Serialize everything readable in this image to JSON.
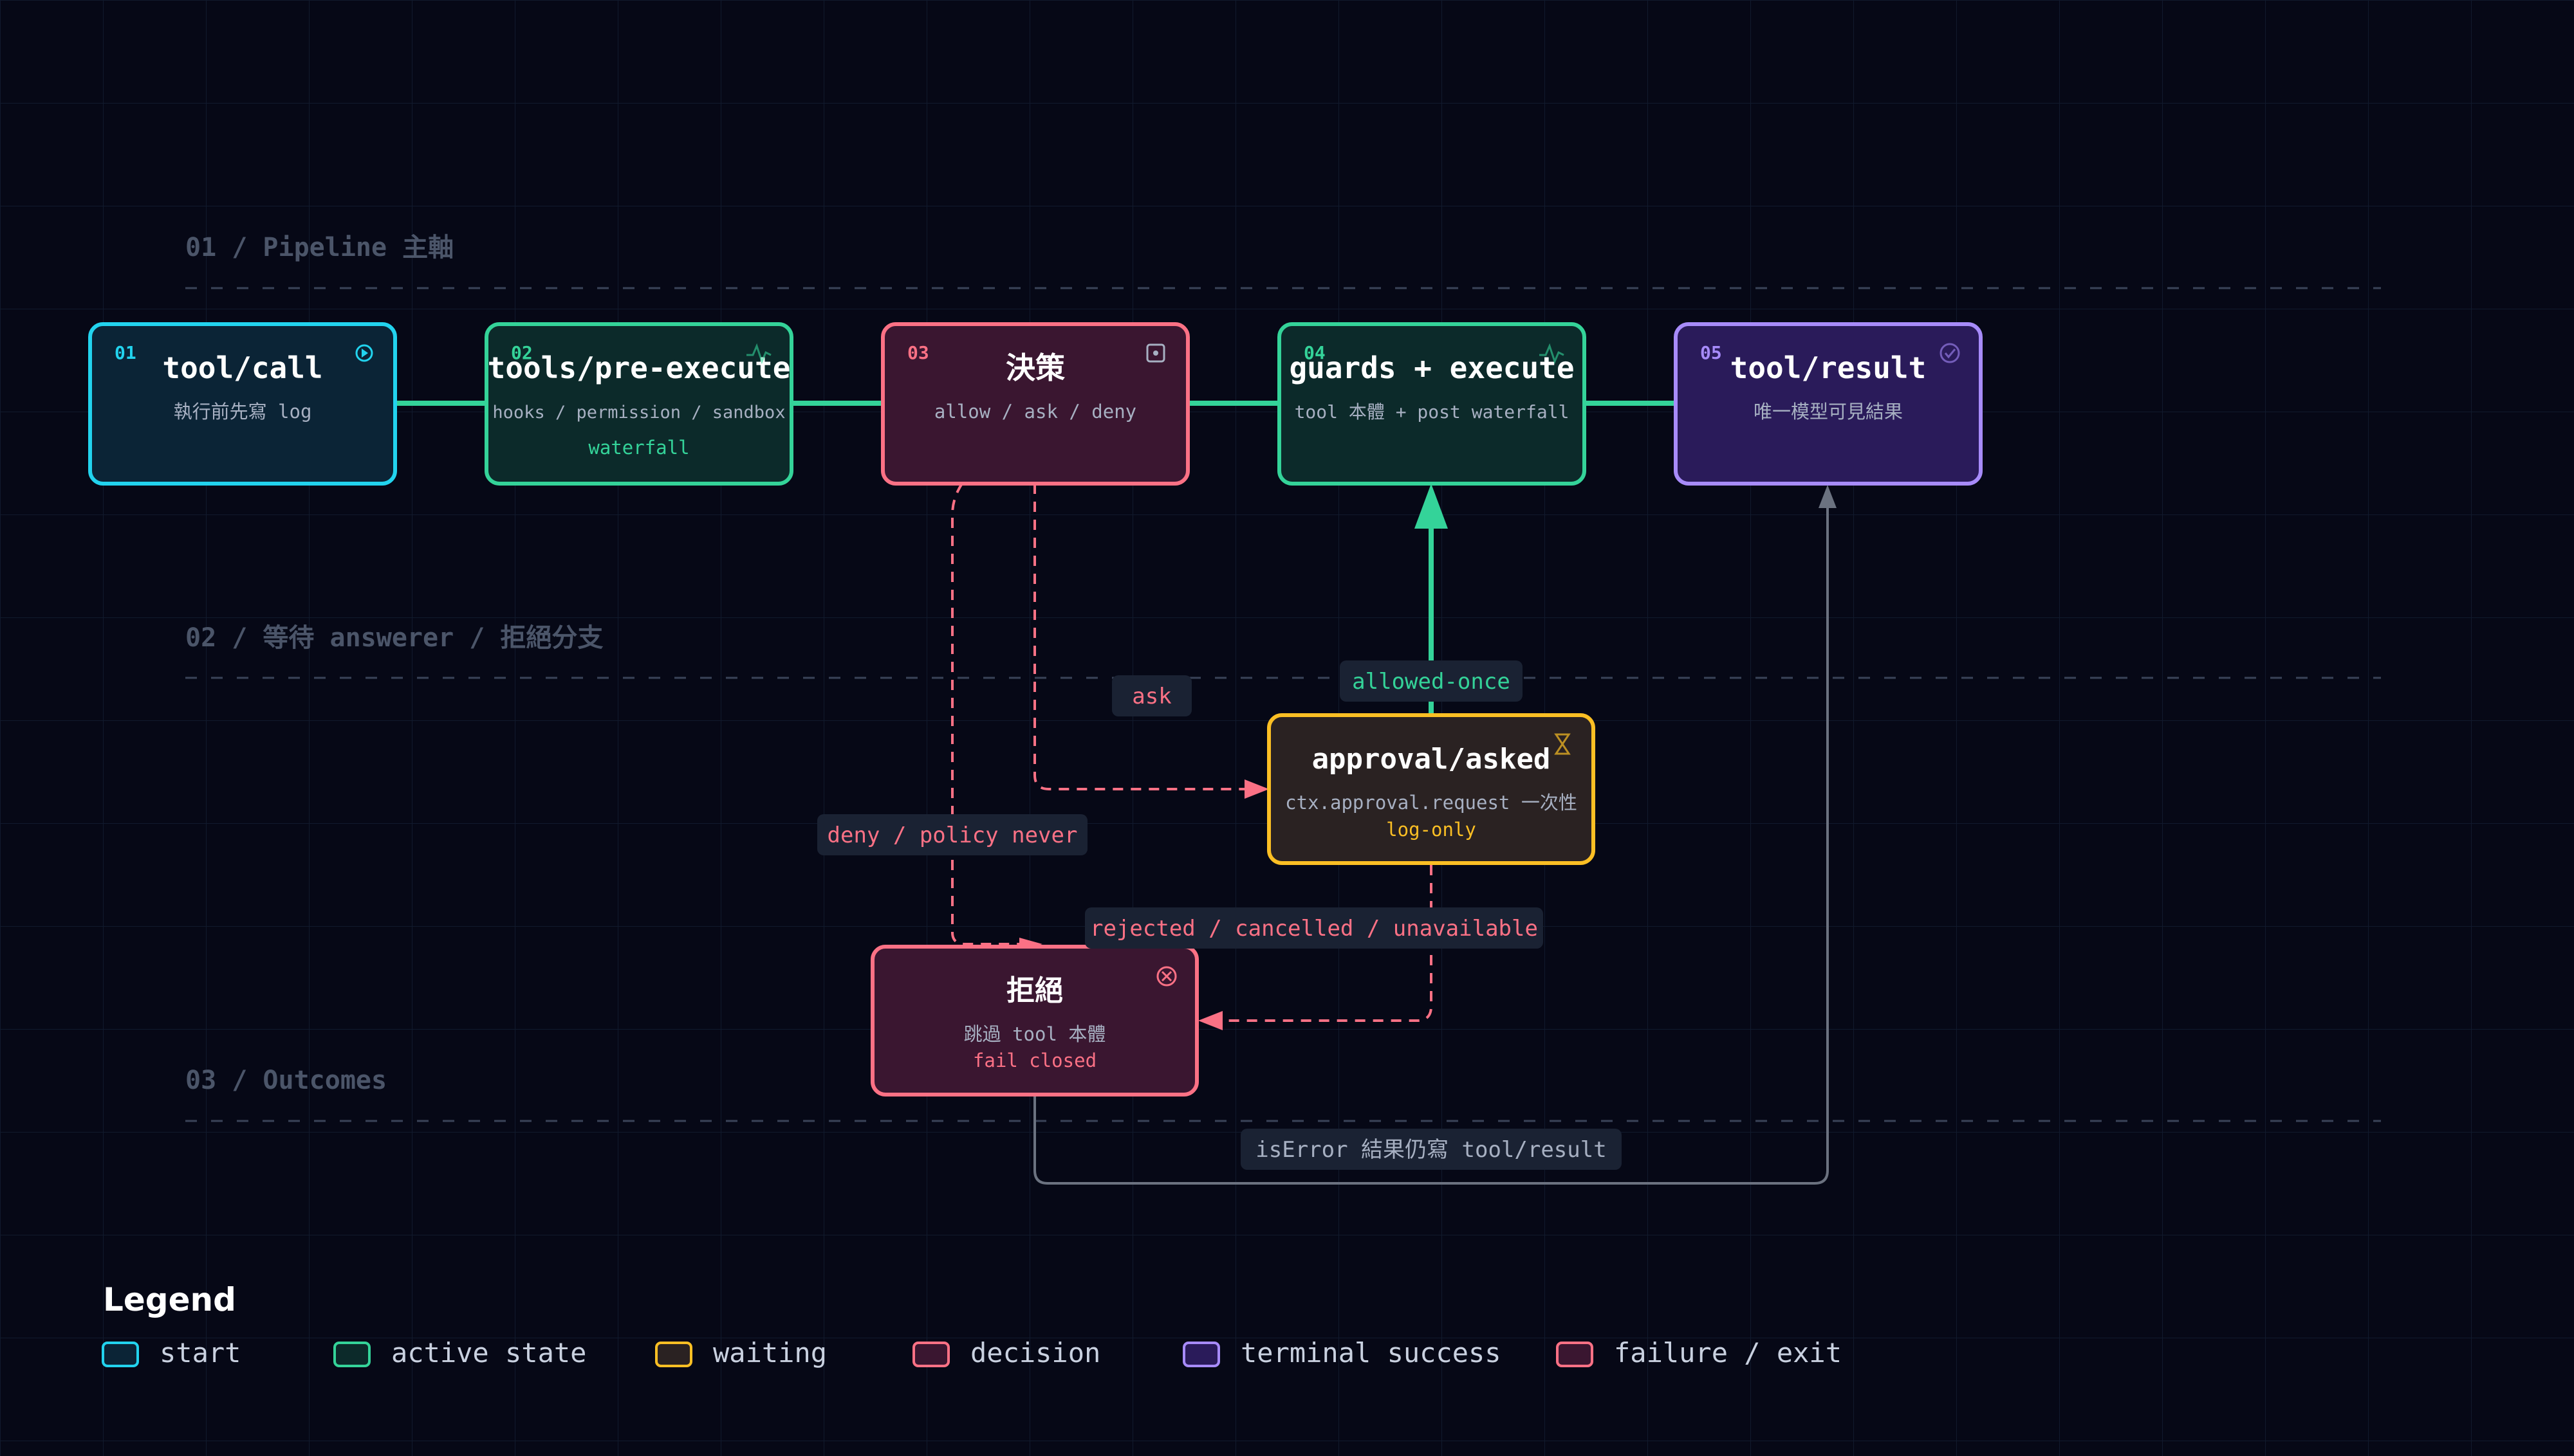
{
  "sections": [
    {
      "label": "01 / Pipeline 主軸"
    },
    {
      "label": "02 / 等待 answerer / 拒絕分支"
    },
    {
      "label": "03 / Outcomes"
    }
  ],
  "nodes": {
    "tool_call": {
      "num": "01",
      "title": "tool/call",
      "sub": "執行前先寫 log",
      "icon": "play-icon"
    },
    "pre_execute": {
      "num": "02",
      "title": "tools/pre-execute",
      "sub": "hooks / permission / sandbox",
      "note": "waterfall",
      "icon": "pulse-icon"
    },
    "decision": {
      "num": "03",
      "title": "決策",
      "sub": "allow / ask / deny",
      "icon": "square-dot-icon"
    },
    "guards_execute": {
      "num": "04",
      "title": "guards + execute",
      "sub": "tool 本體 + post waterfall",
      "icon": "pulse-icon"
    },
    "tool_result": {
      "num": "05",
      "title": "tool/result",
      "sub": "唯一模型可見結果",
      "icon": "check-circle-icon"
    },
    "approval": {
      "title": "approval/asked",
      "sub": "ctx.approval.request 一次性",
      "note": "log-only",
      "icon": "hourglass-icon"
    },
    "reject": {
      "title": "拒絕",
      "sub": "跳過 tool 本體",
      "note": "fail closed",
      "icon": "x-circle-icon"
    }
  },
  "edge_labels": {
    "ask": "ask",
    "allowed_once": "allowed-once",
    "deny": "deny / policy never",
    "rejected": "rejected / cancelled / unavailable",
    "is_error": "isError 結果仍寫 tool/result"
  },
  "legend": {
    "title": "Legend",
    "items": [
      {
        "label": "start",
        "color": "#22d3ee"
      },
      {
        "label": "active state",
        "color": "#34d399"
      },
      {
        "label": "waiting",
        "color": "#fbbf24"
      },
      {
        "label": "decision",
        "color": "#fb7185"
      },
      {
        "label": "terminal success",
        "color": "#a78bfa"
      },
      {
        "label": "failure / exit",
        "color": "#fb7185"
      }
    ]
  },
  "colors": {
    "background": "#060816",
    "grid": "#121a2e",
    "green": "#34d399",
    "pink": "#fb7185",
    "amber": "#fbbf24",
    "violet": "#a78bfa",
    "cyan": "#22d3ee",
    "gray": "#6b7280"
  }
}
